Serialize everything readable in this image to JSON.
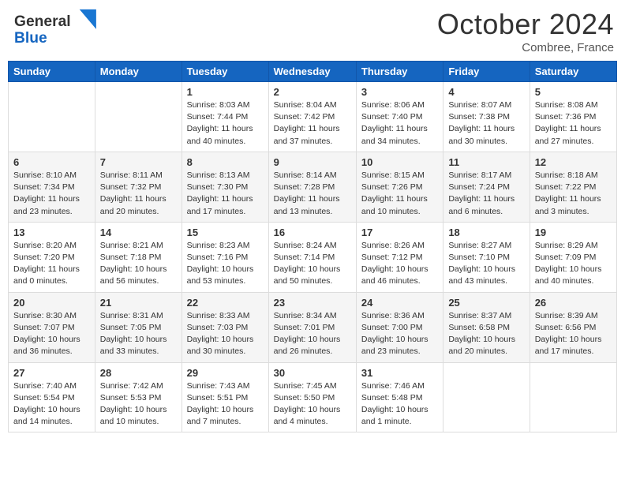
{
  "header": {
    "logo_line1": "General",
    "logo_line2": "Blue",
    "month": "October 2024",
    "location": "Combree, France"
  },
  "days_of_week": [
    "Sunday",
    "Monday",
    "Tuesday",
    "Wednesday",
    "Thursday",
    "Friday",
    "Saturday"
  ],
  "weeks": [
    [
      {
        "num": "",
        "info": ""
      },
      {
        "num": "",
        "info": ""
      },
      {
        "num": "1",
        "info": "Sunrise: 8:03 AM\nSunset: 7:44 PM\nDaylight: 11 hours and 40 minutes."
      },
      {
        "num": "2",
        "info": "Sunrise: 8:04 AM\nSunset: 7:42 PM\nDaylight: 11 hours and 37 minutes."
      },
      {
        "num": "3",
        "info": "Sunrise: 8:06 AM\nSunset: 7:40 PM\nDaylight: 11 hours and 34 minutes."
      },
      {
        "num": "4",
        "info": "Sunrise: 8:07 AM\nSunset: 7:38 PM\nDaylight: 11 hours and 30 minutes."
      },
      {
        "num": "5",
        "info": "Sunrise: 8:08 AM\nSunset: 7:36 PM\nDaylight: 11 hours and 27 minutes."
      }
    ],
    [
      {
        "num": "6",
        "info": "Sunrise: 8:10 AM\nSunset: 7:34 PM\nDaylight: 11 hours and 23 minutes."
      },
      {
        "num": "7",
        "info": "Sunrise: 8:11 AM\nSunset: 7:32 PM\nDaylight: 11 hours and 20 minutes."
      },
      {
        "num": "8",
        "info": "Sunrise: 8:13 AM\nSunset: 7:30 PM\nDaylight: 11 hours and 17 minutes."
      },
      {
        "num": "9",
        "info": "Sunrise: 8:14 AM\nSunset: 7:28 PM\nDaylight: 11 hours and 13 minutes."
      },
      {
        "num": "10",
        "info": "Sunrise: 8:15 AM\nSunset: 7:26 PM\nDaylight: 11 hours and 10 minutes."
      },
      {
        "num": "11",
        "info": "Sunrise: 8:17 AM\nSunset: 7:24 PM\nDaylight: 11 hours and 6 minutes."
      },
      {
        "num": "12",
        "info": "Sunrise: 8:18 AM\nSunset: 7:22 PM\nDaylight: 11 hours and 3 minutes."
      }
    ],
    [
      {
        "num": "13",
        "info": "Sunrise: 8:20 AM\nSunset: 7:20 PM\nDaylight: 11 hours and 0 minutes."
      },
      {
        "num": "14",
        "info": "Sunrise: 8:21 AM\nSunset: 7:18 PM\nDaylight: 10 hours and 56 minutes."
      },
      {
        "num": "15",
        "info": "Sunrise: 8:23 AM\nSunset: 7:16 PM\nDaylight: 10 hours and 53 minutes."
      },
      {
        "num": "16",
        "info": "Sunrise: 8:24 AM\nSunset: 7:14 PM\nDaylight: 10 hours and 50 minutes."
      },
      {
        "num": "17",
        "info": "Sunrise: 8:26 AM\nSunset: 7:12 PM\nDaylight: 10 hours and 46 minutes."
      },
      {
        "num": "18",
        "info": "Sunrise: 8:27 AM\nSunset: 7:10 PM\nDaylight: 10 hours and 43 minutes."
      },
      {
        "num": "19",
        "info": "Sunrise: 8:29 AM\nSunset: 7:09 PM\nDaylight: 10 hours and 40 minutes."
      }
    ],
    [
      {
        "num": "20",
        "info": "Sunrise: 8:30 AM\nSunset: 7:07 PM\nDaylight: 10 hours and 36 minutes."
      },
      {
        "num": "21",
        "info": "Sunrise: 8:31 AM\nSunset: 7:05 PM\nDaylight: 10 hours and 33 minutes."
      },
      {
        "num": "22",
        "info": "Sunrise: 8:33 AM\nSunset: 7:03 PM\nDaylight: 10 hours and 30 minutes."
      },
      {
        "num": "23",
        "info": "Sunrise: 8:34 AM\nSunset: 7:01 PM\nDaylight: 10 hours and 26 minutes."
      },
      {
        "num": "24",
        "info": "Sunrise: 8:36 AM\nSunset: 7:00 PM\nDaylight: 10 hours and 23 minutes."
      },
      {
        "num": "25",
        "info": "Sunrise: 8:37 AM\nSunset: 6:58 PM\nDaylight: 10 hours and 20 minutes."
      },
      {
        "num": "26",
        "info": "Sunrise: 8:39 AM\nSunset: 6:56 PM\nDaylight: 10 hours and 17 minutes."
      }
    ],
    [
      {
        "num": "27",
        "info": "Sunrise: 7:40 AM\nSunset: 5:54 PM\nDaylight: 10 hours and 14 minutes."
      },
      {
        "num": "28",
        "info": "Sunrise: 7:42 AM\nSunset: 5:53 PM\nDaylight: 10 hours and 10 minutes."
      },
      {
        "num": "29",
        "info": "Sunrise: 7:43 AM\nSunset: 5:51 PM\nDaylight: 10 hours and 7 minutes."
      },
      {
        "num": "30",
        "info": "Sunrise: 7:45 AM\nSunset: 5:50 PM\nDaylight: 10 hours and 4 minutes."
      },
      {
        "num": "31",
        "info": "Sunrise: 7:46 AM\nSunset: 5:48 PM\nDaylight: 10 hours and 1 minute."
      },
      {
        "num": "",
        "info": ""
      },
      {
        "num": "",
        "info": ""
      }
    ]
  ]
}
